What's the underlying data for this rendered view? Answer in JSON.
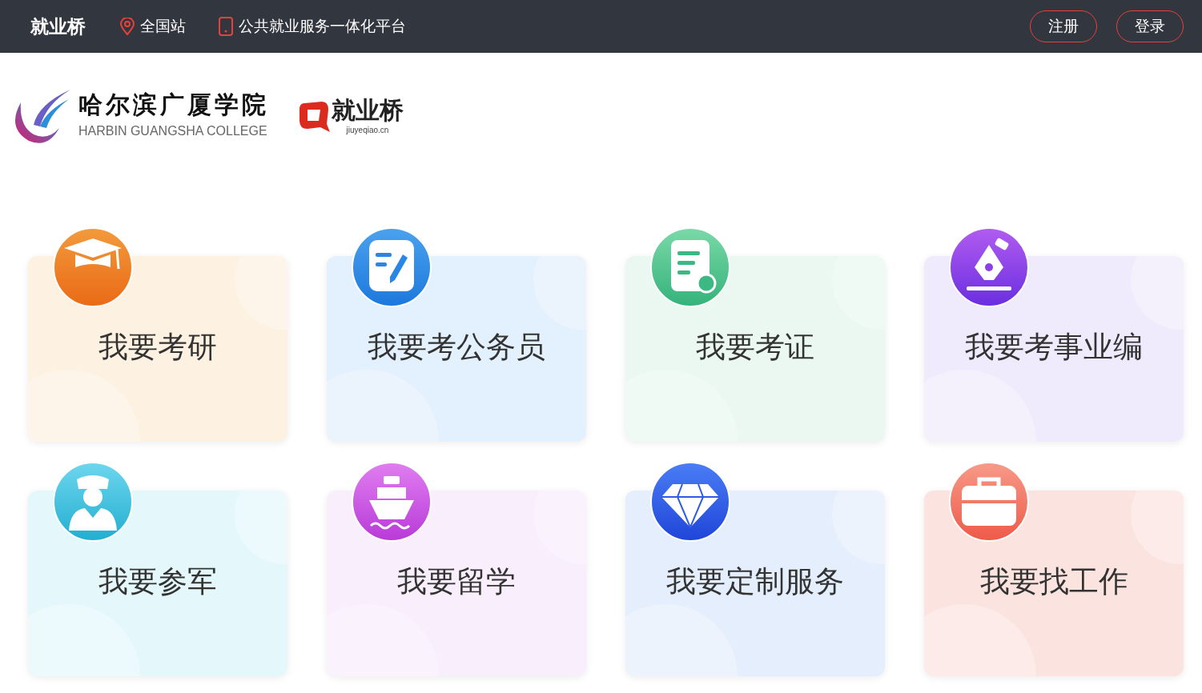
{
  "header": {
    "brand": "就业桥",
    "links": [
      {
        "kind": "location",
        "label": "全国站"
      },
      {
        "kind": "phone",
        "label": "公共就业服务一体化平台"
      }
    ],
    "buttons": [
      "注册",
      "登录"
    ]
  },
  "logos": {
    "college": {
      "name": "哈尔滨广厦学院",
      "english": "HARBIN GUANGSHA COLLEGE"
    },
    "platform": {
      "name": "就业桥",
      "domain": "jiuyeqiao.cn"
    }
  },
  "cards": [
    {
      "label": "我要考研",
      "kind": "graduation",
      "color": "#fdf1e1"
    },
    {
      "label": "我要考公务员",
      "kind": "edit",
      "color": "#e3f0fd"
    },
    {
      "label": "我要考证",
      "kind": "certificate",
      "color": "#eaf8f1"
    },
    {
      "label": "我要考事业编",
      "kind": "pen",
      "color": "#efebfc"
    },
    {
      "label": "我要参军",
      "kind": "soldier",
      "color": "#e4f8fc"
    },
    {
      "label": "我要留学",
      "kind": "ship",
      "color": "#f8eefc"
    },
    {
      "label": "我要定制服务",
      "kind": "diamond",
      "color": "#e4eefd"
    },
    {
      "label": "我要找工作",
      "kind": "briefcase",
      "color": "#fbe3df"
    }
  ]
}
